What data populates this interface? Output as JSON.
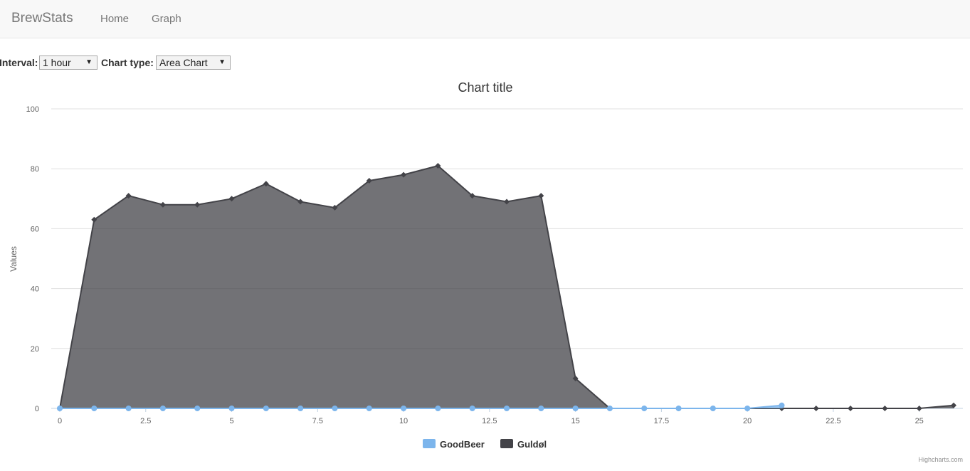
{
  "navbar": {
    "brand": "BrewStats",
    "links": [
      "Home",
      "Graph"
    ]
  },
  "controls": {
    "interval_label": "Interval:",
    "interval_value": "1 hour",
    "chart_type_label": "Chart type:",
    "chart_type_value": "Area Chart"
  },
  "credit": "Highcharts.com",
  "chart_data": {
    "type": "area",
    "title": "Chart title",
    "ylabel": "Values",
    "xlabel": "",
    "ylim": [
      0,
      100
    ],
    "xlim": [
      0,
      26
    ],
    "y_ticks": [
      0,
      20,
      40,
      60,
      80,
      100
    ],
    "x_ticks": [
      0,
      2.5,
      5,
      7.5,
      10,
      12.5,
      15,
      17.5,
      20,
      22.5,
      25
    ],
    "grid": true,
    "legend_position": "bottom-center",
    "series": [
      {
        "name": "GoodBeer",
        "color": "#7cb5ec",
        "marker": "circle",
        "x": [
          0,
          1,
          2,
          3,
          4,
          5,
          6,
          7,
          8,
          9,
          10,
          11,
          12,
          13,
          14,
          15,
          16,
          17,
          18,
          19,
          20,
          21
        ],
        "values": [
          0,
          0,
          0,
          0,
          0,
          0,
          0,
          0,
          0,
          0,
          0,
          0,
          0,
          0,
          0,
          0,
          0,
          0,
          0,
          0,
          0,
          1
        ]
      },
      {
        "name": "Guldøl",
        "color": "#434348",
        "marker": "diamond",
        "x": [
          0,
          1,
          2,
          3,
          4,
          5,
          6,
          7,
          8,
          9,
          10,
          11,
          12,
          13,
          14,
          15,
          16,
          17,
          18,
          19,
          20,
          21,
          22,
          23,
          24,
          25,
          26
        ],
        "values": [
          0,
          63,
          71,
          68,
          68,
          70,
          75,
          69,
          67,
          76,
          78,
          81,
          71,
          69,
          71,
          10,
          0,
          0,
          0,
          0,
          0,
          0,
          0,
          0,
          0,
          0,
          1
        ]
      }
    ]
  }
}
